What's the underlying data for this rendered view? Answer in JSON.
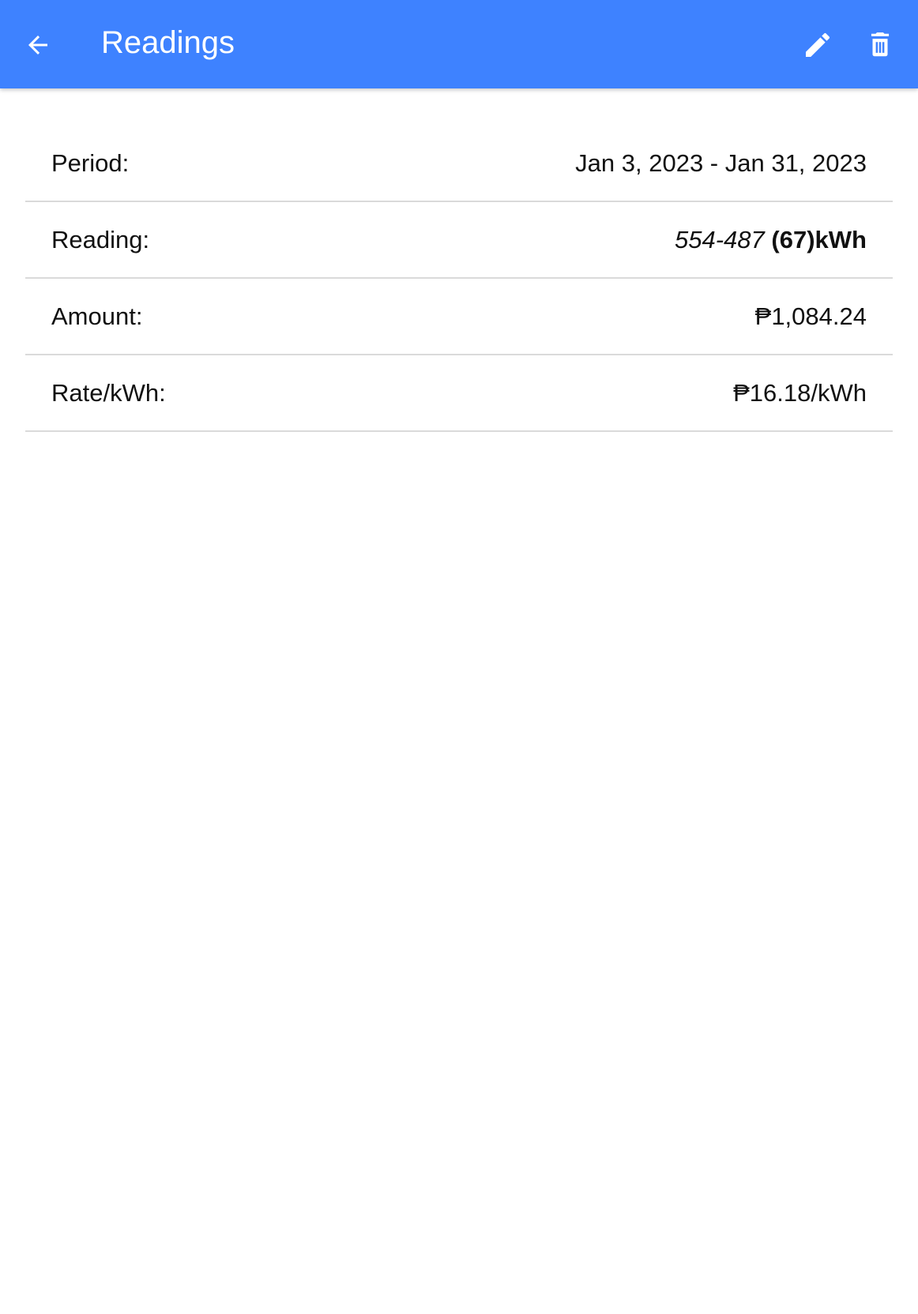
{
  "app_bar": {
    "title": "Readings",
    "back_icon": "arrow-back-icon",
    "edit_icon": "pencil-icon",
    "delete_icon": "trash-icon",
    "background_color": "#3e82ff"
  },
  "details": {
    "period": {
      "label": "Period:",
      "value": "Jan 3, 2023 - Jan 31, 2023"
    },
    "reading": {
      "label": "Reading:",
      "range": "554-487",
      "total": "(67)kWh"
    },
    "amount": {
      "label": "Amount:",
      "value": "₱1,084.24"
    },
    "rate": {
      "label": "Rate/kWh:",
      "value": "₱16.18/kWh"
    }
  }
}
